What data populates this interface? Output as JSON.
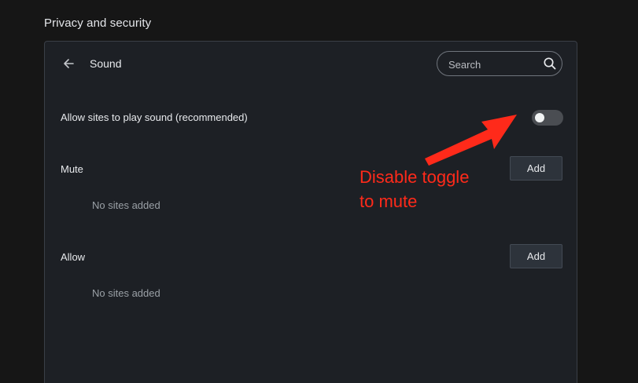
{
  "section": {
    "title": "Privacy and security"
  },
  "panel": {
    "title": "Sound",
    "back_icon": "arrow-left-icon"
  },
  "search": {
    "placeholder": "Search",
    "icon": "search-icon"
  },
  "sound_setting": {
    "label": "Allow sites to play sound (recommended)",
    "enabled": false
  },
  "mute": {
    "label": "Mute",
    "add_label": "Add",
    "empty_text": "No sites added"
  },
  "allow": {
    "label": "Allow",
    "add_label": "Add",
    "empty_text": "No sites added"
  },
  "annotation": {
    "line1": "Disable toggle",
    "line2": "to mute",
    "color": "#ff2a1a"
  },
  "colors": {
    "background": "#161616",
    "panel": "#1d2025",
    "button": "#2d333b",
    "toggle_off": "#4a4d52"
  }
}
